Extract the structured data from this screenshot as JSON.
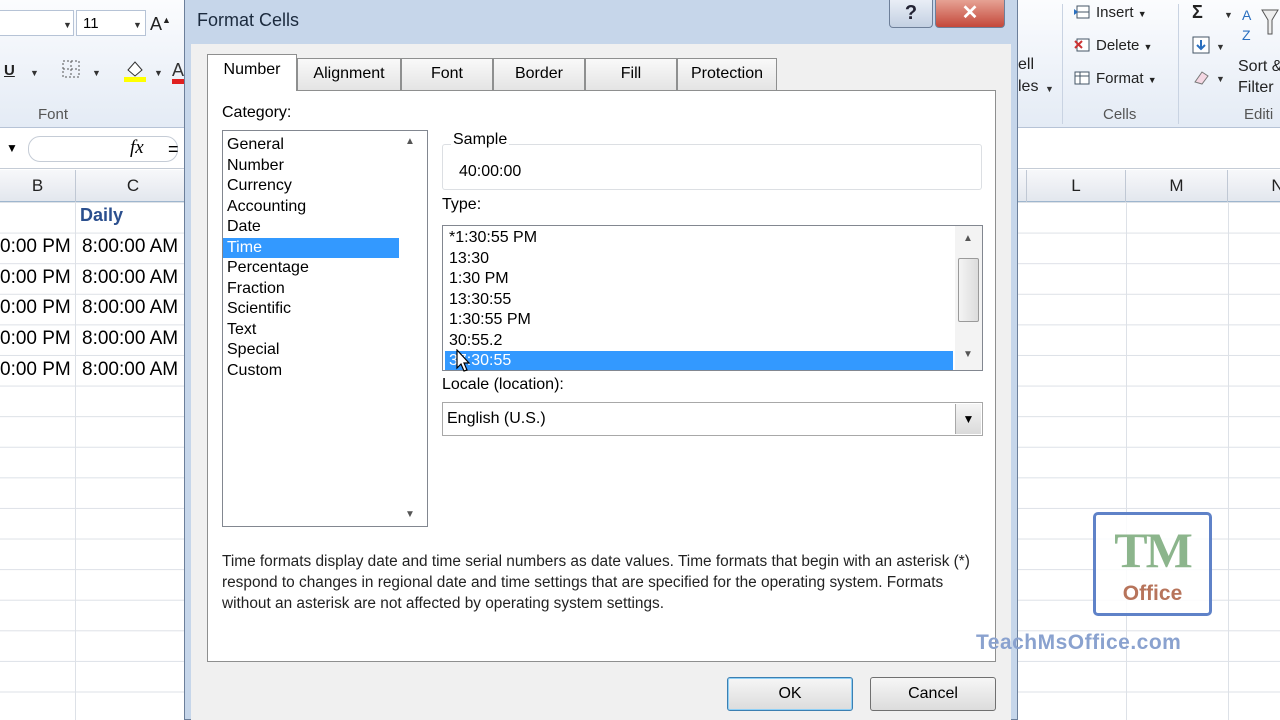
{
  "excel": {
    "ribbon": {
      "font_size": "11",
      "font_group_label": "Font",
      "cells_group_label": "Cells",
      "editing_group_label": "Editi",
      "insert_label": "Insert",
      "delete_label": "Delete",
      "format_label": "Format",
      "sort_label": "Sort &",
      "filter_label": "Filter",
      "cell_styles_label_1": "ell",
      "cell_styles_label_2": "les",
      "underline_label": "U",
      "sigma_label": "Σ"
    },
    "formula_bar": {
      "fx_label": "fx",
      "content": "="
    },
    "columns": [
      "B",
      "C",
      "L",
      "M",
      "N"
    ],
    "cells": {
      "header_c": "Daily",
      "col_b": [
        "0:00 PM",
        "0:00 PM",
        "0:00 PM",
        "0:00 PM",
        "0:00 PM"
      ],
      "col_c": [
        "8:00:00 AM",
        "8:00:00 AM",
        "8:00:00 AM",
        "8:00:00 AM",
        "8:00:00 AM"
      ]
    }
  },
  "dialog": {
    "title": "Format Cells",
    "help_label": "?",
    "close_label": "✕",
    "tabs": [
      "Number",
      "Alignment",
      "Font",
      "Border",
      "Fill",
      "Protection"
    ],
    "active_tab": "Number",
    "category_label": "Category:",
    "categories": [
      "General",
      "Number",
      "Currency",
      "Accounting",
      "Date",
      "Time",
      "Percentage",
      "Fraction",
      "Scientific",
      "Text",
      "Special",
      "Custom"
    ],
    "selected_category": "Time",
    "sample_label": "Sample",
    "sample_value": "40:00:00",
    "type_label": "Type:",
    "types": [
      "*1:30:55 PM",
      "13:30",
      "1:30 PM",
      "13:30:55",
      "1:30:55 PM",
      "30:55.2",
      "37:30:55"
    ],
    "selected_type": "37:30:55",
    "locale_label": "Locale (location):",
    "locale_value": "English (U.S.)",
    "description": "Time formats display date and time serial numbers as date values.  Time formats that begin with an asterisk (*) respond to changes in regional date and time settings that are specified for the operating system. Formats without an asterisk are not affected by operating system settings.",
    "ok_label": "OK",
    "cancel_label": "Cancel"
  },
  "watermark": {
    "logo_tm": "TM",
    "logo_office": "Office",
    "url": "TeachMsOffice.com"
  }
}
